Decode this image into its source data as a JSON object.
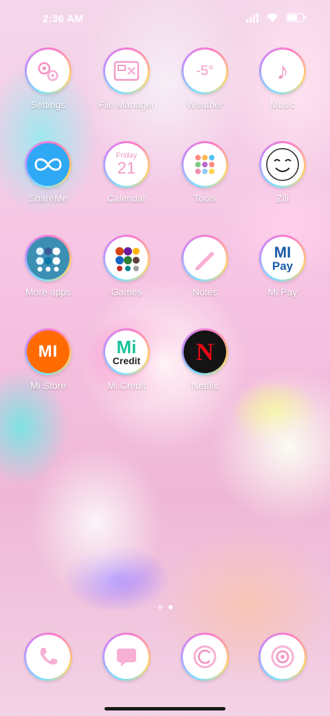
{
  "status_bar": {
    "time": "2:36 AM"
  },
  "rows": [
    [
      {
        "label": "Settings",
        "icon": "settings-icon"
      },
      {
        "label": "File Manager",
        "icon": "folder-icon"
      },
      {
        "label": "Weather",
        "icon": "weather-icon",
        "badge": "-5°"
      },
      {
        "label": "Music",
        "icon": "music-note-icon"
      }
    ],
    [
      {
        "label": "ShareMe",
        "icon": "shareme-icon"
      },
      {
        "label": "Calendar",
        "icon": "calendar-icon",
        "day_name": "Friday",
        "day_num": "21"
      },
      {
        "label": "Tools",
        "icon": "tools-folder-icon"
      },
      {
        "label": "Zili",
        "icon": "zili-face-icon"
      }
    ],
    [
      {
        "label": "More apps",
        "icon": "more-apps-folder-icon"
      },
      {
        "label": "Games",
        "icon": "games-folder-icon"
      },
      {
        "label": "Notes",
        "icon": "notes-icon"
      },
      {
        "label": "Mi Pay",
        "icon": "mi-pay-icon",
        "brand_top": "MI",
        "brand_bottom": "Pay"
      }
    ],
    [
      {
        "label": "Mi Store",
        "icon": "mi-store-icon",
        "brand": "MI"
      },
      {
        "label": "Mi Credit",
        "icon": "mi-credit-icon",
        "brand": "Mi",
        "sub": "Credit"
      },
      {
        "label": "Netflix",
        "icon": "netflix-icon",
        "brand": "N"
      }
    ]
  ],
  "page_indicator": {
    "count": 2,
    "active": 2
  },
  "dock": [
    {
      "icon": "phone-icon"
    },
    {
      "icon": "messages-icon"
    },
    {
      "icon": "browser-icon"
    },
    {
      "icon": "camera-icon"
    }
  ],
  "colors": {
    "accent_pink": "#f19ac6",
    "mi_orange": "#ff6b00",
    "netflix_red": "#e50914",
    "shareme_blue": "#2fa8f5",
    "micredit_green": "#19c39a",
    "mipay_blue": "#1a5aa8"
  }
}
